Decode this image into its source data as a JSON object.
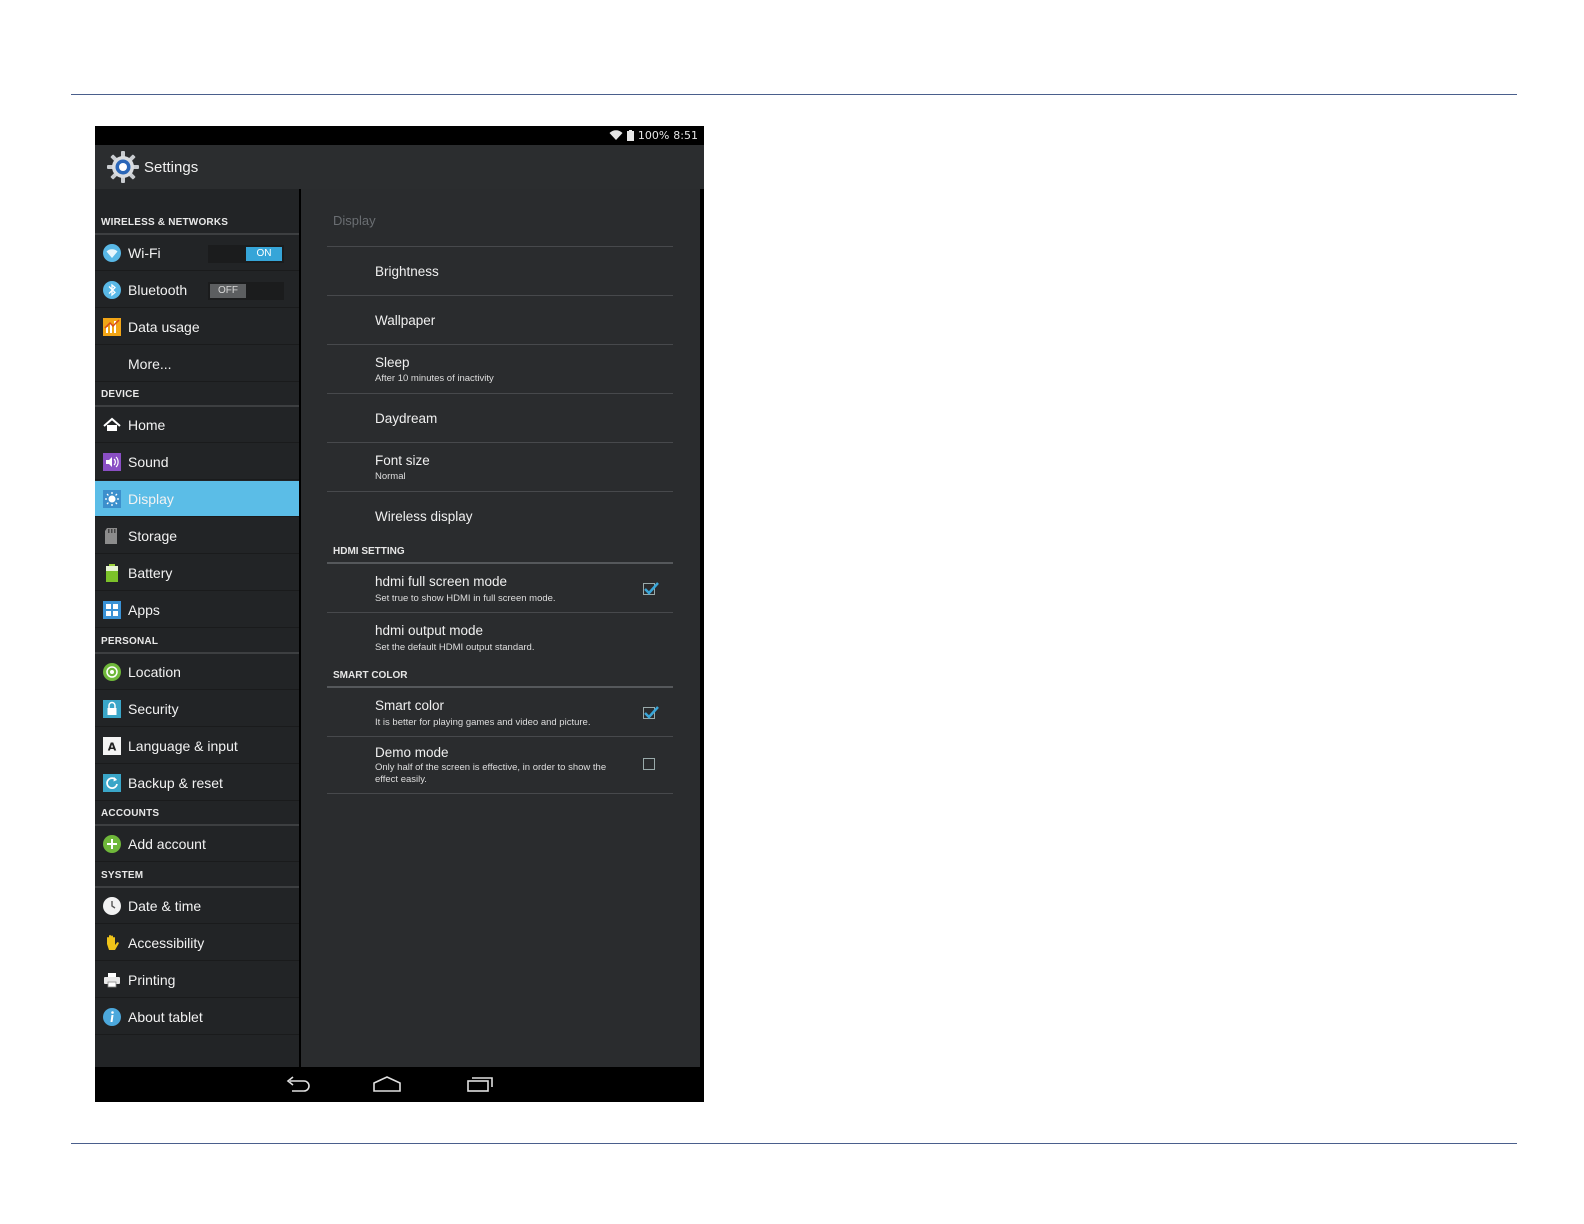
{
  "status": {
    "battery": "100%",
    "time": "8:51"
  },
  "app": {
    "title": "Settings"
  },
  "sidebar": {
    "sections": [
      {
        "header": "WIRELESS & NETWORKS"
      },
      {
        "header": "DEVICE"
      },
      {
        "header": "PERSONAL"
      },
      {
        "header": "ACCOUNTS"
      },
      {
        "header": "SYSTEM"
      }
    ],
    "items": [
      {
        "label": "Wi-Fi",
        "icon": "wifi-icon",
        "toggle": "ON"
      },
      {
        "label": "Bluetooth",
        "icon": "bluetooth-icon",
        "toggle": "OFF"
      },
      {
        "label": "Data usage",
        "icon": "data-usage-icon"
      },
      {
        "label": "More..."
      },
      {
        "label": "Home",
        "icon": "home-icon"
      },
      {
        "label": "Sound",
        "icon": "sound-icon"
      },
      {
        "label": "Display",
        "icon": "display-icon",
        "active": true
      },
      {
        "label": "Storage",
        "icon": "storage-icon"
      },
      {
        "label": "Battery",
        "icon": "battery-icon"
      },
      {
        "label": "Apps",
        "icon": "apps-icon"
      },
      {
        "label": "Location",
        "icon": "location-icon"
      },
      {
        "label": "Security",
        "icon": "lock-icon"
      },
      {
        "label": "Language & input",
        "icon": "language-icon"
      },
      {
        "label": "Backup & reset",
        "icon": "backup-icon"
      },
      {
        "label": "Add account",
        "icon": "add-icon"
      },
      {
        "label": "Date & time",
        "icon": "clock-icon"
      },
      {
        "label": "Accessibility",
        "icon": "hand-icon"
      },
      {
        "label": "Printing",
        "icon": "printer-icon"
      },
      {
        "label": "About tablet",
        "icon": "info-icon"
      }
    ]
  },
  "detail": {
    "title": "Display",
    "rows": [
      {
        "title": "Brightness"
      },
      {
        "title": "Wallpaper"
      },
      {
        "title": "Sleep",
        "summary": "After 10 minutes of inactivity"
      },
      {
        "title": "Daydream"
      },
      {
        "title": "Font size",
        "summary": "Normal"
      },
      {
        "title": "Wireless display"
      }
    ],
    "hdmi": {
      "header": "HDMI SETTING",
      "rows": [
        {
          "title": "hdmi full screen mode",
          "summary": "Set true to show HDMI in full screen mode.",
          "checked": true
        },
        {
          "title": "hdmi output mode",
          "summary": "Set the default HDMI output standard."
        }
      ]
    },
    "smart": {
      "header": "SMART COLOR",
      "rows": [
        {
          "title": "Smart color",
          "summary": "It is better for playing games and video and picture.",
          "checked": true
        },
        {
          "title": "Demo mode",
          "summary": "Only half of the screen is effective, in order to show the effect easily.",
          "checked": false
        }
      ]
    }
  },
  "colors": {
    "accent": "#5bbde7",
    "toggle_on": "#36a5d8"
  }
}
